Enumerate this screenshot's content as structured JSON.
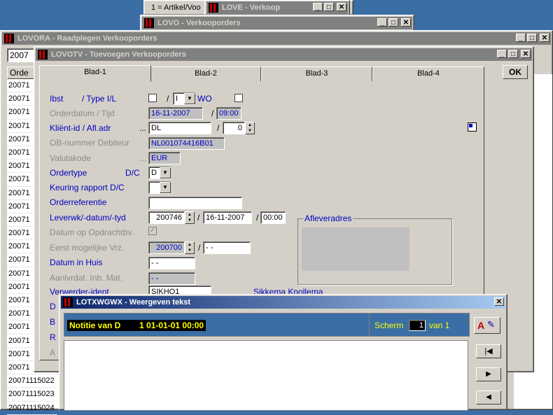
{
  "bg_windows": {
    "artikel_label": "1 = Artikel/Voo",
    "love_title": "LOVE - Verkoop",
    "lovo_title": "LOVO - Verkooporders"
  },
  "lovora": {
    "title": "LOVORA - Raadplegen Verkooporders",
    "filter_value": "2007",
    "col_header": "Orde",
    "rows": [
      "20071",
      "20071",
      "20071",
      "20071",
      "20071",
      "20071",
      "20071",
      "20071",
      "20071",
      "20071",
      "20071",
      "20071",
      "20071",
      "20071",
      "20071",
      "20071",
      "20071",
      "20071",
      "20071",
      "20071",
      "20071",
      "20071"
    ],
    "rows_bottom": [
      "20071115022",
      "20071115023",
      "20071115024"
    ]
  },
  "lovotv": {
    "title": "LOVOTV - Toevoegen Verkooporders",
    "ok_label": "OK",
    "tabs": [
      "Blad-1",
      "Blad-2",
      "Blad-3",
      "Blad-4"
    ],
    "labels": {
      "ibst": "Ibst",
      "type": "/ Type I/L",
      "wo": "WO",
      "orderdatum": "Orderdatum / Tijd",
      "klient": "Kliënt-id / Afl.adr",
      "ob_nummer": "OB-nummer Debiteur",
      "valutakode": "Valutakode",
      "ordertype": "Ordertype",
      "dc": "D/C",
      "keuring": "Keuring rapport D/C",
      "orderreferentie": "Orderreferentie",
      "leverwk": "Leverwk/-datum/-tyd",
      "afleveradres": "Afleveradres",
      "datum_opdracht": "Datum op Opdrachtbv.",
      "eerst_mogelijk": "Eerst mogelijke Vrz.",
      "datum_in_huis": "Datum in Huis",
      "aanlvrdat": "Aanlvrdat. Inb. Mat.",
      "verwerder": "Verwerder-ident",
      "sikkema": "Sikkema Knollema",
      "trunc_d": "D",
      "trunc_b": "B",
      "trunc_r": "R",
      "trunc_a": "A",
      "slash": "/",
      "dots": "..."
    },
    "values": {
      "type_il": "I",
      "orderdatum": "16-11-2007",
      "tijd": "09:00",
      "klient_id": "DL",
      "afl_adr": "0",
      "ob_nummer": "NL001074416B01",
      "valutakode": "EUR",
      "ordertype": "D",
      "keuring": "",
      "orderreferentie": "",
      "leverwk": "200746",
      "leverdatum": "16-11-2007",
      "levertyd": "00:00",
      "datum_opdracht_check": "✓",
      "eerst_mogelijk_wk": "200700",
      "eerst_mogelijk_datum": "- -",
      "datum_in_huis": "- -",
      "aanlvrdat": "- -",
      "verwerder": "SIKHO1"
    }
  },
  "lotxwgwx": {
    "title": "LOTXWGWX - Weergeven tekst",
    "notitie": "Notitie van D        1 01-01-01 00:00",
    "scherm_label": "Scherm",
    "scherm_value": "1",
    "van_label": "van 1",
    "text": ""
  },
  "colors": {
    "titlebar_active": "#0a246a",
    "titlebar_inactive": "#808080",
    "label_blue": "#0000c0",
    "notitie_yellow": "#ffff00",
    "panel_blue": "#3a6ea5"
  }
}
